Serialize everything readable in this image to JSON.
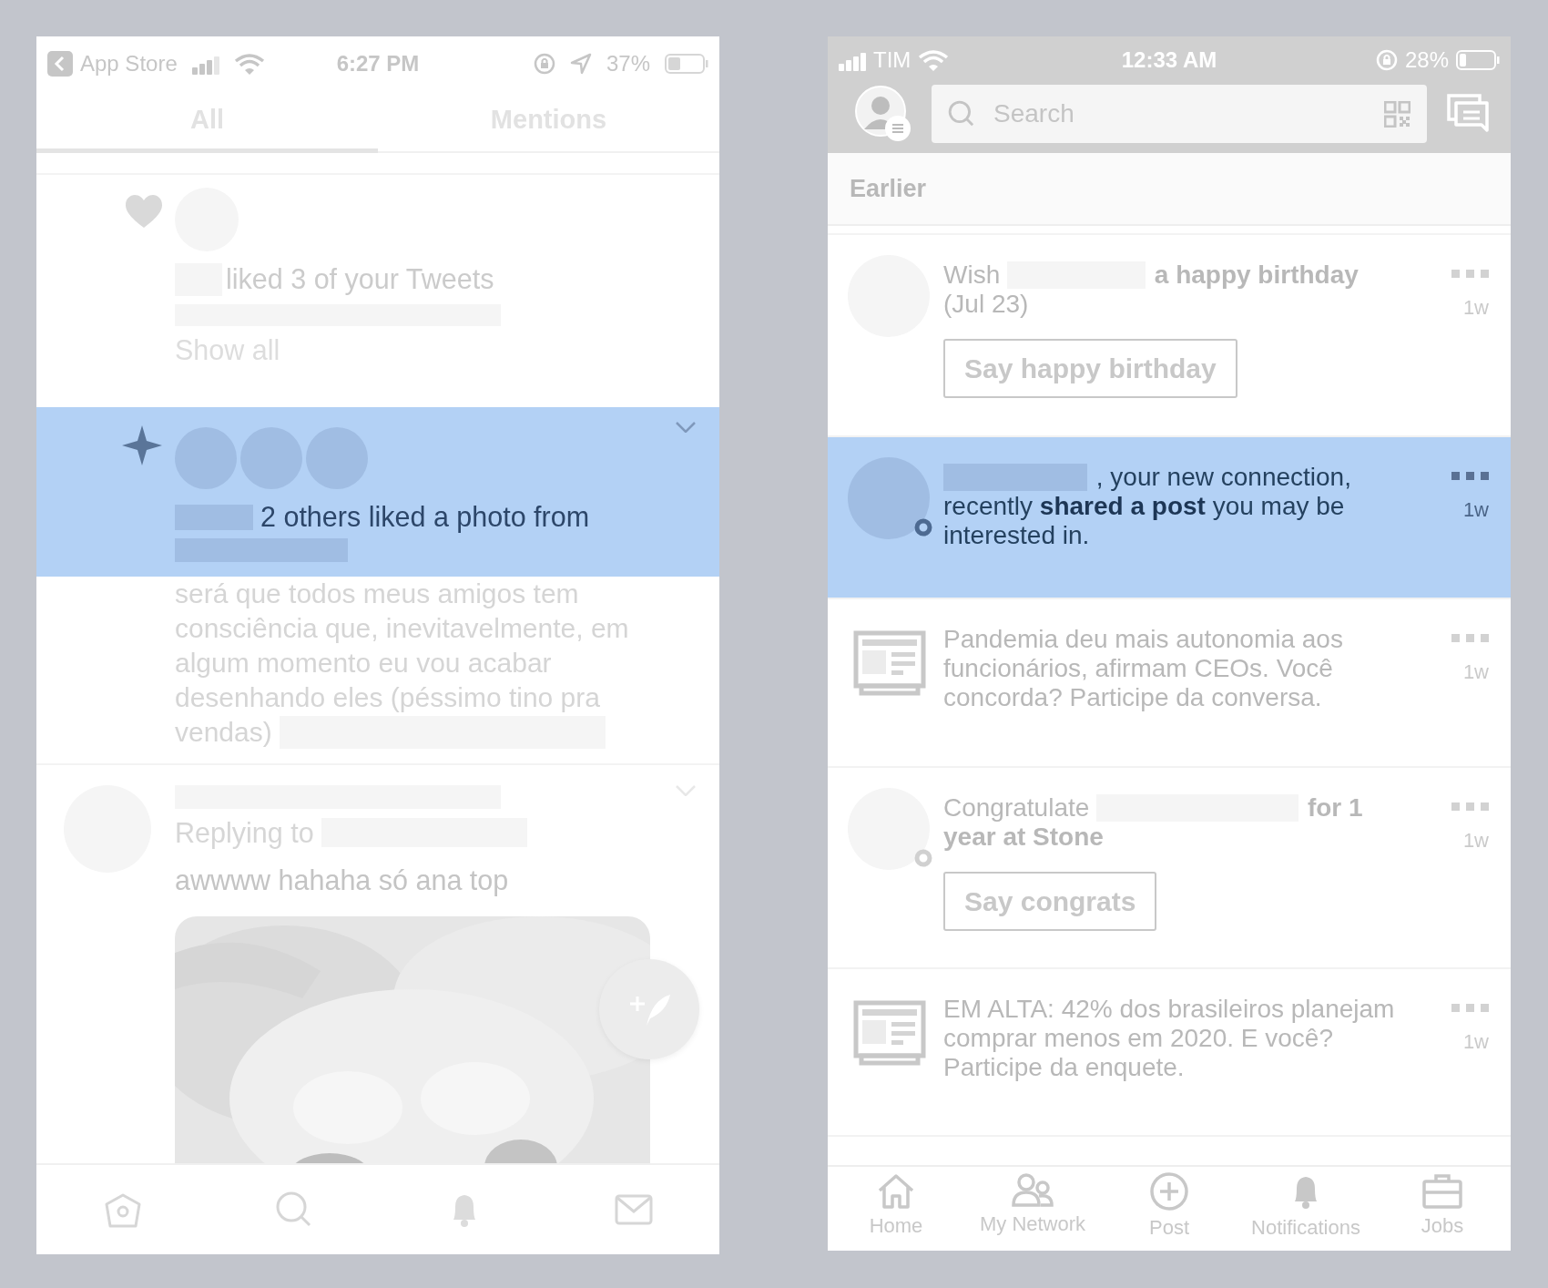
{
  "left_screen": {
    "status_bar": {
      "back_label": "App Store",
      "time": "6:27 PM",
      "battery": "37%"
    },
    "tabs": [
      {
        "label": "All",
        "selected": true
      },
      {
        "label": "Mentions",
        "selected": false
      }
    ],
    "notifications": [
      {
        "kind": "like",
        "highlighted": false,
        "text": "liked 3 of your Tweets",
        "link": "Show all"
      },
      {
        "kind": "photo_like",
        "highlighted": true,
        "text": "2 others liked a photo from",
        "body": "será que todos meus amigos tem consciência que, inevitavelmente, em algum momento eu vou acabar desenhando eles (péssimo tino pra vendas)"
      }
    ],
    "tweet": {
      "replying_label": "Replying to",
      "text": "awwww hahaha só ana top"
    }
  },
  "right_screen": {
    "status_bar": {
      "carrier": "TIM",
      "time": "12:33 AM",
      "battery": "28%"
    },
    "search": {
      "placeholder": "Search"
    },
    "section_title": "Earlier",
    "notifications": [
      {
        "kind": "birthday",
        "highlighted": false,
        "before": "Wish",
        "after": "**a happy birthday** (Jul 23)",
        "button": "Say happy birthday",
        "time": "1w"
      },
      {
        "kind": "share",
        "highlighted": true,
        "after": ", your new connection, recently **shared a post** you may be interested in.",
        "time": "1w"
      },
      {
        "kind": "news",
        "highlighted": false,
        "after": "Pandemia deu mais autonomia aos funcionários, afirmam CEOs. Você concorda? Participe da conversa.",
        "time": "1w"
      },
      {
        "kind": "anniversary",
        "highlighted": false,
        "before": "Congratulate",
        "after": "**for 1 year at Stone**",
        "button": "Say congrats",
        "time": "1w"
      },
      {
        "kind": "news",
        "highlighted": false,
        "after": "EM ALTA: 42% dos brasileiros planejam comprar menos em 2020. E você? Participe da enquete.",
        "time": "1w"
      }
    ],
    "nav": [
      {
        "label": "Home"
      },
      {
        "label": "My Network"
      },
      {
        "label": "Post"
      },
      {
        "label": "Notifications"
      },
      {
        "label": "Jobs"
      }
    ]
  }
}
